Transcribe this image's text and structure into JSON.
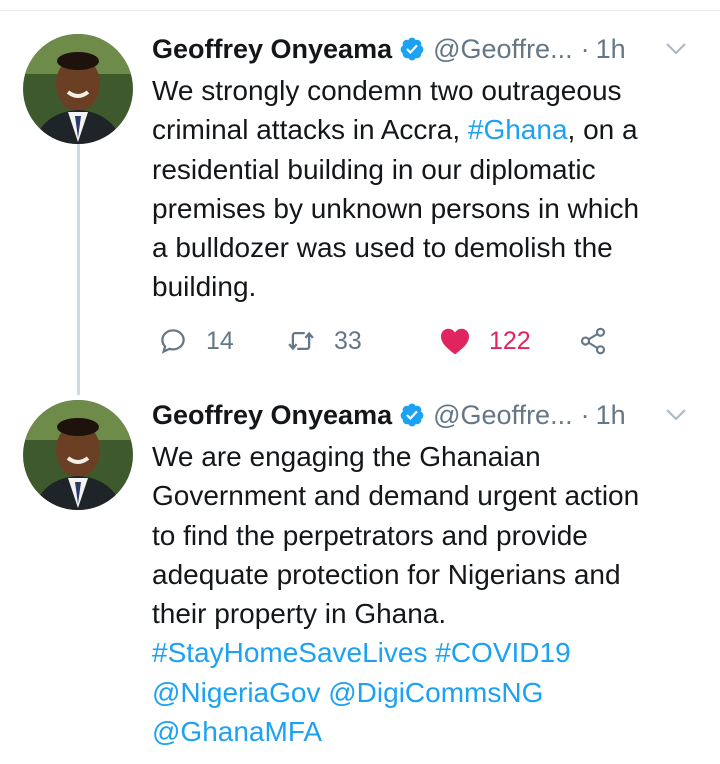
{
  "colors": {
    "link": "#1da1f2",
    "muted": "#657786",
    "like": "#e0245e",
    "verified": "#1da1f2",
    "thread_line": "#cfd9de"
  },
  "tweets": [
    {
      "author": "Geoffrey Onyeama",
      "verified": true,
      "handle": "@Geoffre...",
      "separator": "·",
      "time": "1h",
      "text_lines": [
        [
          "We strongly condemn two outrageous"
        ],
        [
          "criminal attacks in Accra, ",
          "#Ghana",
          ", on a"
        ],
        [
          "residential building in our diplomatic"
        ],
        [
          "premises by unknown persons in which"
        ],
        [
          "a bulldozer was used to demolish the"
        ],
        [
          "building."
        ]
      ],
      "actions": {
        "replies": "14",
        "retweets": "33",
        "likes": "122",
        "liked": true
      }
    },
    {
      "author": "Geoffrey Onyeama",
      "verified": true,
      "handle": "@Geoffre...",
      "separator": "·",
      "time": "1h",
      "text_lines": [
        [
          "We are engaging the Ghanaian"
        ],
        [
          "Government and demand urgent action"
        ],
        [
          "to find the perpetrators and provide"
        ],
        [
          "adequate protection for Nigerians and"
        ],
        [
          "their property in Ghana."
        ],
        [
          "#StayHomeSaveLives #COVID19"
        ],
        [
          "@NigeriaGov @DigiCommsNG"
        ],
        [
          "@GhanaMFA"
        ]
      ]
    }
  ],
  "icons": {
    "avatar": "avatar-photo",
    "verified": "verified-badge-icon",
    "caret": "chevron-down-icon",
    "reply": "reply-icon",
    "retweet": "retweet-icon",
    "like": "heart-icon",
    "share": "share-icon"
  }
}
